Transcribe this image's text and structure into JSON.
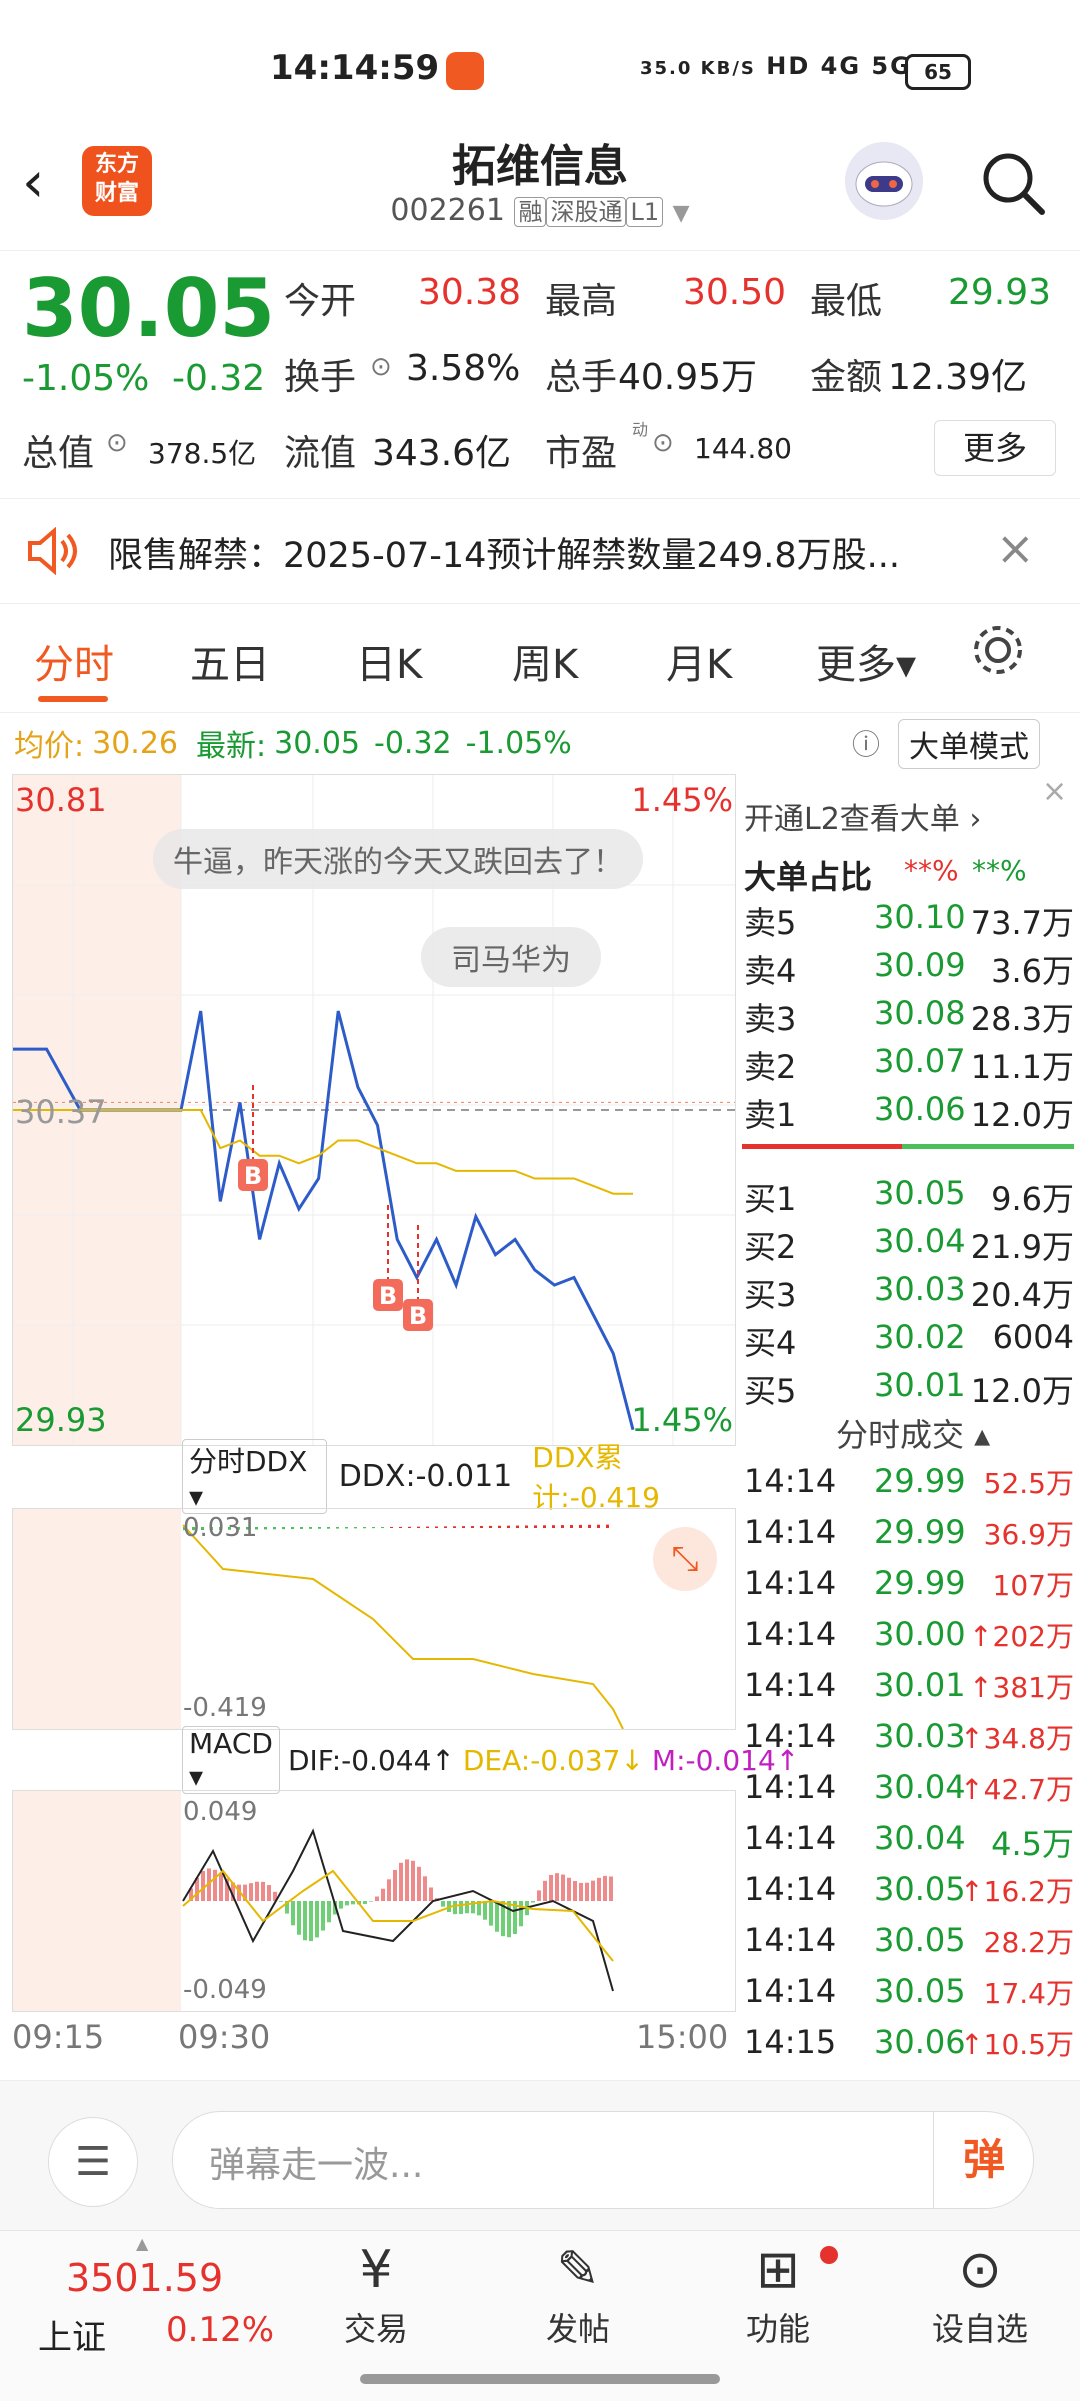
{
  "status": {
    "time": "14:14:59",
    "speed": "35.0 KB/S",
    "net": "HD  4G  5G",
    "battery": "65"
  },
  "header": {
    "logo_line1": "东方",
    "logo_line2": "财富",
    "title": "拓维信息",
    "code": "002261",
    "tags": [
      "融",
      "深股通",
      "L1"
    ]
  },
  "quote": {
    "price": "30.05",
    "change_pct": "-1.05%",
    "change": "-0.32",
    "open_label": "今开",
    "open": "30.38",
    "high_label": "最高",
    "high": "30.50",
    "low_label": "最低",
    "low": "29.93",
    "turnover_label": "换手",
    "turnover": "3.58%",
    "volume_label": "总手",
    "volume": "40.95万",
    "amount_label": "金额",
    "amount": "12.39亿",
    "mcap_label": "总值",
    "mcap": "378.5亿",
    "float_label": "流值",
    "float": "343.6亿",
    "pe_label": "市盈",
    "pe_sup": "动",
    "pe": "144.80",
    "more": "更多"
  },
  "notice": {
    "text": "限售解禁：2025-07-14预计解禁数量249.8万股..."
  },
  "tabs": [
    "分时",
    "五日",
    "日K",
    "周K",
    "月K",
    "更多▾"
  ],
  "avg_bar": {
    "avg_label": "均价:",
    "avg": "30.26",
    "latest_label": "最新:",
    "latest": "30.05",
    "chg": "-0.32",
    "pct": "-1.05%",
    "mode_btn": "大单模式"
  },
  "chart_data": {
    "type": "line",
    "title": "",
    "x_ticks": [
      "09:15",
      "09:30",
      "15:00"
    ],
    "ylim": [
      29.93,
      30.81
    ],
    "y_top": "30.81",
    "y_mid": "30.37",
    "y_bottom": "29.93",
    "pct_top": "1.45%",
    "pct_bottom": "1.45%",
    "series": [
      {
        "name": "price",
        "values": [
          30.45,
          30.45,
          30.37,
          30.37,
          30.37,
          30.37,
          30.5,
          30.25,
          30.38,
          30.2,
          30.3,
          30.24,
          30.28,
          30.5,
          30.4,
          30.35,
          30.2,
          30.15,
          30.2,
          30.14,
          30.23,
          30.18,
          30.2,
          30.16,
          30.14,
          30.15,
          30.1,
          30.05,
          29.95
        ]
      },
      {
        "name": "avg",
        "values": [
          30.37,
          30.37,
          30.37,
          30.37,
          30.37,
          30.37,
          30.37,
          30.32,
          30.33,
          30.31,
          30.31,
          30.3,
          30.31,
          30.33,
          30.33,
          30.32,
          30.31,
          30.3,
          30.3,
          30.29,
          30.29,
          30.29,
          30.29,
          30.28,
          30.28,
          30.28,
          30.27,
          30.26,
          30.26
        ]
      }
    ],
    "bubbles": [
      "牛逼，昨天涨的今天又跌回去了！",
      "司马华为"
    ],
    "markers": [
      "B",
      "B",
      "B"
    ],
    "ddx": {
      "label": "分时DDX ▾",
      "value": "DDX:-0.011",
      "cum": "DDX累计:-0.419",
      "top": "0.031",
      "bottom": "-0.419"
    },
    "macd": {
      "label": "MACD ▾",
      "dif": "DIF:-0.044↑",
      "dea": "DEA:-0.037↓",
      "m": "M:-0.014↑",
      "top": "0.049",
      "bottom": "-0.049"
    }
  },
  "orderbook": {
    "l2_link": "开通L2查看大单 ›",
    "big_ratio_label": "大单占比",
    "big_sell": "**%",
    "big_buy": "**%",
    "asks": [
      [
        "卖5",
        "30.10",
        "73.7万"
      ],
      [
        "卖4",
        "30.09",
        "3.6万"
      ],
      [
        "卖3",
        "30.08",
        "28.3万"
      ],
      [
        "卖2",
        "30.07",
        "11.1万"
      ],
      [
        "卖1",
        "30.06",
        "12.0万"
      ]
    ],
    "bids": [
      [
        "买1",
        "30.05",
        "9.6万"
      ],
      [
        "买2",
        "30.04",
        "21.9万"
      ],
      [
        "买3",
        "30.03",
        "20.4万"
      ],
      [
        "买4",
        "30.02",
        "6004"
      ],
      [
        "买5",
        "30.01",
        "12.0万"
      ]
    ],
    "ticks_title": "分时成交 ▴",
    "ticks": [
      [
        "14:14",
        "29.99",
        "52.5万",
        ""
      ],
      [
        "14:14",
        "29.99",
        "36.9万",
        ""
      ],
      [
        "14:14",
        "29.99",
        "107万",
        ""
      ],
      [
        "14:14",
        "30.00",
        "202万",
        "↑"
      ],
      [
        "14:14",
        "30.01",
        "381万",
        "↑"
      ],
      [
        "14:14",
        "30.03",
        "34.8万",
        "↑"
      ],
      [
        "14:14",
        "30.04",
        "42.7万",
        "↑"
      ],
      [
        "14:14",
        "30.04",
        "4.5万",
        ""
      ],
      [
        "14:14",
        "30.05",
        "16.2万",
        "↑"
      ],
      [
        "14:14",
        "30.05",
        "28.2万",
        ""
      ],
      [
        "14:14",
        "30.05",
        "17.4万",
        ""
      ],
      [
        "14:15",
        "30.06",
        "10.5万",
        "↑"
      ]
    ]
  },
  "input": {
    "placeholder": "弹幕走一波...",
    "danmu_btn": "弹"
  },
  "nav": {
    "index_value": "3501.59",
    "index_name": "上证",
    "index_pct": "0.12%",
    "items": [
      "交易",
      "发帖",
      "功能",
      "设自选"
    ]
  }
}
